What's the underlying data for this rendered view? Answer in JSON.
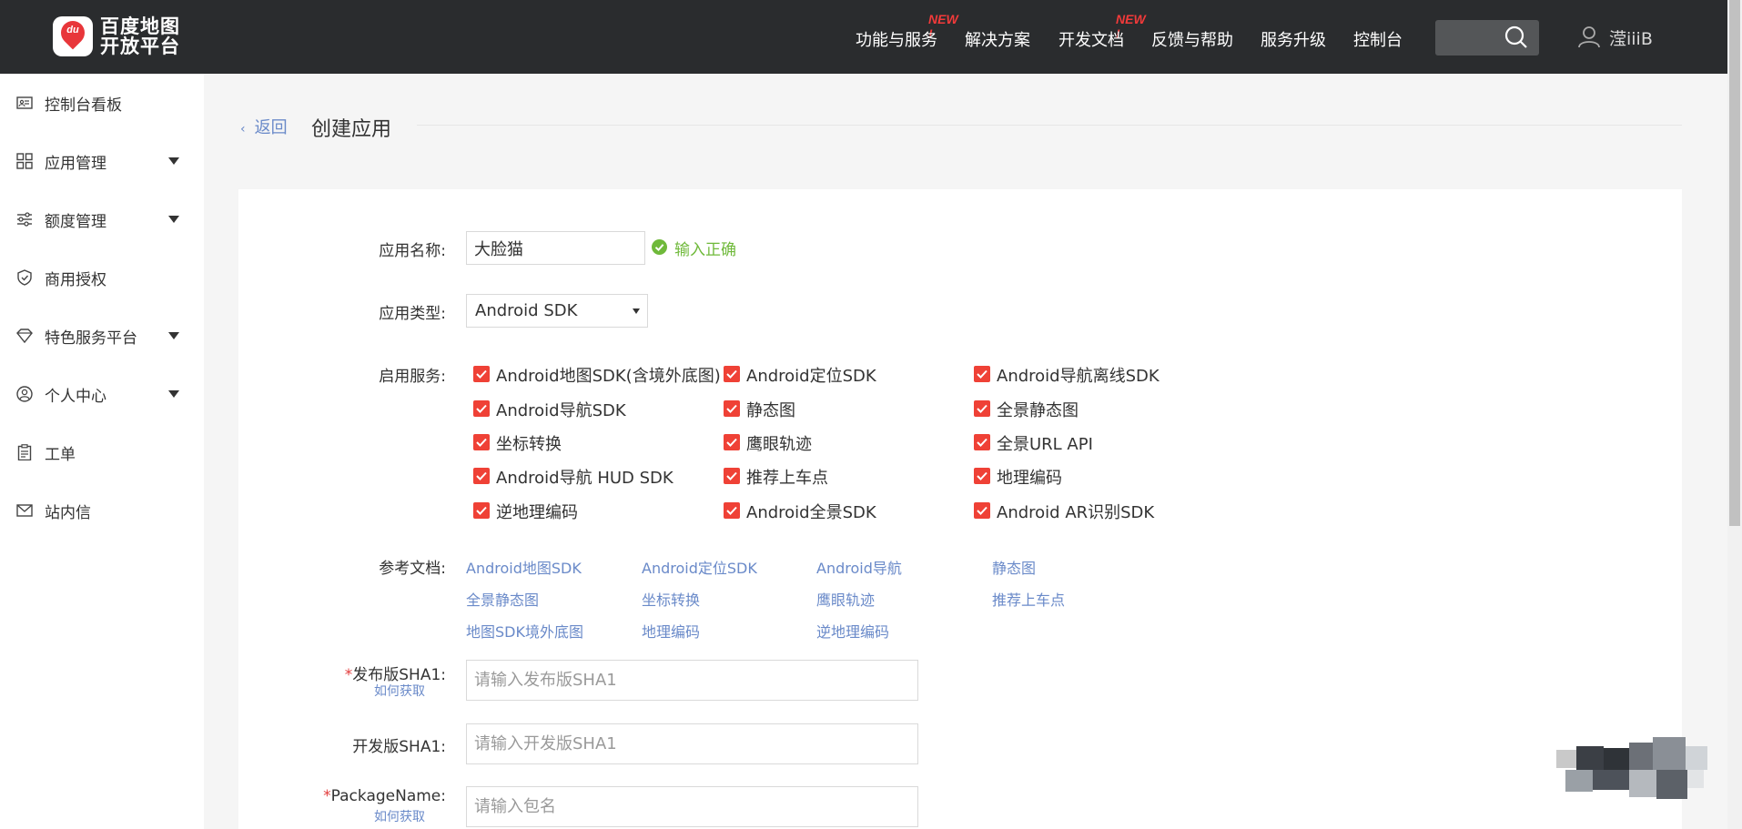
{
  "header": {
    "logo_text_line1": "百度地图",
    "logo_text_line2": "开放平台",
    "logo_badge": "du",
    "nav": [
      {
        "label": "功能与服务",
        "new": "NEW !"
      },
      {
        "label": "解决方案",
        "new": ""
      },
      {
        "label": "开发文档",
        "new": "NEW !"
      },
      {
        "label": "反馈与帮助",
        "new": ""
      },
      {
        "label": "服务升级",
        "new": ""
      },
      {
        "label": "控制台",
        "new": ""
      }
    ],
    "username": "滢iiiB"
  },
  "sidebar": {
    "items": [
      {
        "label": "控制台看板",
        "icon": "dashboard-icon",
        "expandable": false
      },
      {
        "label": "应用管理",
        "icon": "grid-icon",
        "expandable": true
      },
      {
        "label": "额度管理",
        "icon": "sliders-icon",
        "expandable": true
      },
      {
        "label": "商用授权",
        "icon": "shield-icon",
        "expandable": false
      },
      {
        "label": "特色服务平台",
        "icon": "diamond-icon",
        "expandable": true
      },
      {
        "label": "个人中心",
        "icon": "user-circle-icon",
        "expandable": true
      },
      {
        "label": "工单",
        "icon": "clipboard-icon",
        "expandable": false
      },
      {
        "label": "站内信",
        "icon": "mail-icon",
        "expandable": false
      }
    ]
  },
  "page": {
    "back_label": "返回",
    "title": "创建应用"
  },
  "form": {
    "app_name_label": "应用名称:",
    "app_name_value": "大脸猫",
    "app_name_status": "输入正确",
    "app_type_label": "应用类型:",
    "app_type_value": "Android SDK",
    "services_label": "启用服务:",
    "services": [
      "Android地图SDK(含境外底图)",
      "Android定位SDK",
      "Android导航离线SDK",
      "Android导航SDK",
      "静态图",
      "全景静态图",
      "坐标转换",
      "鹰眼轨迹",
      "全景URL API",
      "Android导航 HUD SDK",
      "推荐上车点",
      "地理编码",
      "逆地理编码",
      "Android全景SDK",
      "Android AR识别SDK"
    ],
    "docs_label": "参考文档:",
    "docs": [
      "Android地图SDK",
      "Android定位SDK",
      "Android导航",
      "静态图",
      "全景静态图",
      "坐标转换",
      "鹰眼轨迹",
      "推荐上车点",
      "地图SDK境外底图",
      "地理编码",
      "逆地理编码"
    ],
    "release_sha1_label": "发布版SHA1:",
    "release_sha1_placeholder": "请输入发布版SHA1",
    "how_to_get": "如何获取",
    "dev_sha1_label": "开发版SHA1:",
    "dev_sha1_placeholder": "请输入开发版SHA1",
    "package_label": "PackageName:",
    "package_placeholder": "请输入包名",
    "required_mark": "*"
  },
  "colors": {
    "topbar": "#2a2c2e",
    "checkbox": "#ef4136",
    "link": "#6a8ac9",
    "success": "#6fb93a",
    "new_badge": "#f23a3a"
  }
}
